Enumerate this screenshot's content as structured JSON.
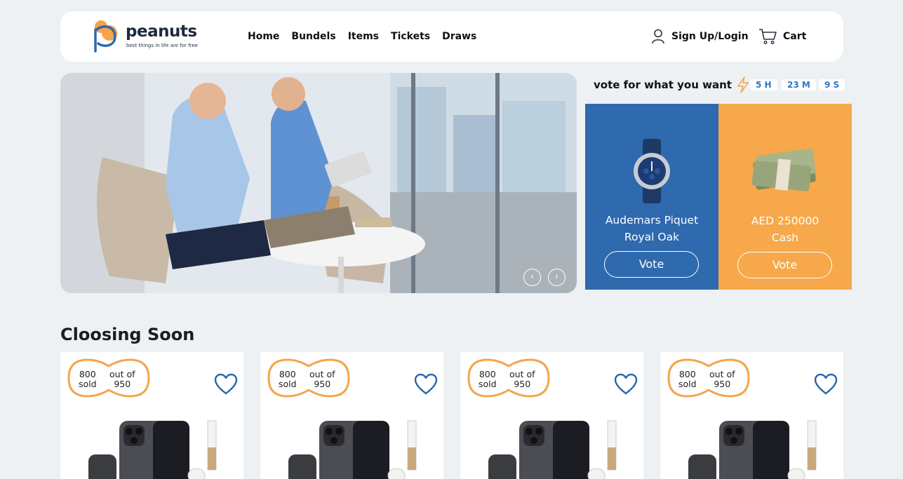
{
  "brand": {
    "name": "peanuts",
    "tagline": "best things in life are for free",
    "accent": "#f5a44b",
    "primary": "#2f69ae"
  },
  "nav": [
    {
      "label": "Home"
    },
    {
      "label": "Bundels"
    },
    {
      "label": "Items"
    },
    {
      "label": "Tickets"
    },
    {
      "label": "Draws"
    }
  ],
  "account": {
    "signup_label": "Sign Up/Login",
    "signup_icon": "user-icon",
    "cart_label": "Cart",
    "cart_icon": "cart-icon"
  },
  "hero": {
    "prev_icon": "chevron-left-icon",
    "next_icon": "chevron-right-icon",
    "prev": "‹",
    "next": "›"
  },
  "vote": {
    "title": "vote for what you want",
    "icon": "lightning-icon",
    "timer": {
      "hours": "5 H",
      "minutes": "23 M",
      "seconds": "9 S"
    },
    "options": [
      {
        "name_line1": "Audemars Piquet",
        "name_line2": "Royal Oak",
        "button": "Vote",
        "color": "#2f69ae"
      },
      {
        "name_line1": "AED 250000",
        "name_line2": "Cash",
        "button": "Vote",
        "color": "#f6a84a"
      }
    ]
  },
  "closing": {
    "title": "Cloosing Soon",
    "cards": [
      {
        "sold": "800",
        "sold_label": "sold",
        "out_of_label": "out of",
        "total": "950"
      },
      {
        "sold": "800",
        "sold_label": "sold",
        "out_of_label": "out of",
        "total": "950"
      },
      {
        "sold": "800",
        "sold_label": "sold",
        "out_of_label": "out of",
        "total": "950"
      },
      {
        "sold": "800",
        "sold_label": "sold",
        "out_of_label": "out of",
        "total": "950"
      }
    ]
  }
}
